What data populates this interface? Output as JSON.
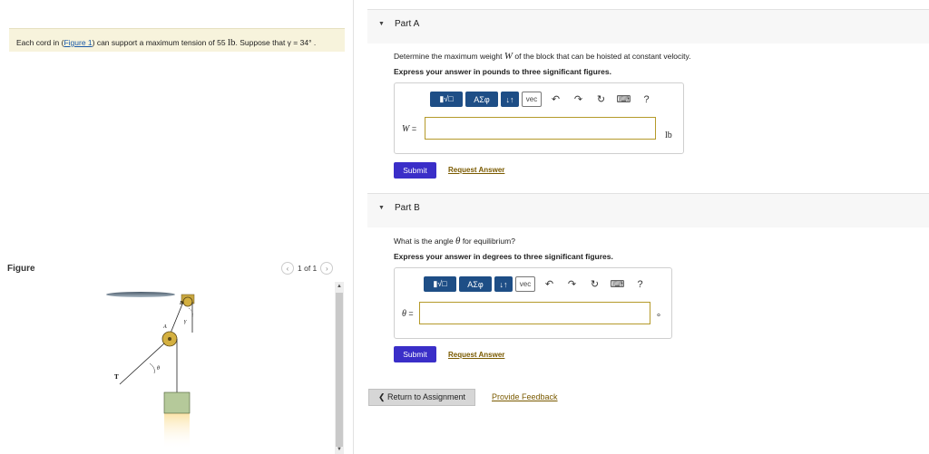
{
  "problem": {
    "text_before": "Each cord in (",
    "figure_link": "Figure 1",
    "text_middle": ") can support a maximum tension of 55 ",
    "unit": "lb",
    "text_after": ". Suppose that γ = 34° ."
  },
  "figure": {
    "label": "Figure",
    "pager": "1 of 1",
    "prev_arrow": "‹",
    "next_arrow": "›",
    "labels": {
      "A": "A",
      "B": "B",
      "gamma": "γ",
      "theta": "θ",
      "T": "T"
    }
  },
  "partA": {
    "title": "Part A",
    "question_before": "Determine the maximum weight ",
    "question_sym": "W",
    "question_after": " of the block that can be hoisted at constant velocity.",
    "instruction": "Express your answer in pounds to three significant figures.",
    "answer_label_sym": "W",
    "answer_label_eq": " =",
    "answer_value": "",
    "unit": "lb",
    "submit": "Submit",
    "request": "Request Answer"
  },
  "partB": {
    "title": "Part B",
    "question_before": "What is the angle ",
    "question_sym": "θ",
    "question_after": " for equilibrium?",
    "instruction": "Express your answer in degrees to three significant figures.",
    "answer_label_sym": "θ",
    "answer_label_eq": " =",
    "answer_value": "",
    "unit": "°",
    "submit": "Submit",
    "request": "Request Answer"
  },
  "toolbar": {
    "templates": "▮√□",
    "greek": "ΑΣφ",
    "arrows": "↓↑",
    "vec": "vec",
    "undo": "↶",
    "redo": "↷",
    "reset": "↻",
    "keyboard": "⌨",
    "help": "?"
  },
  "footer": {
    "return": "❮ Return to Assignment",
    "feedback": "Provide Feedback"
  },
  "colors": {
    "submit": "#3a2ec8",
    "toolbar": "#1e4e86",
    "problem_bg": "#f7f3dc",
    "link": "#7a5a00"
  }
}
